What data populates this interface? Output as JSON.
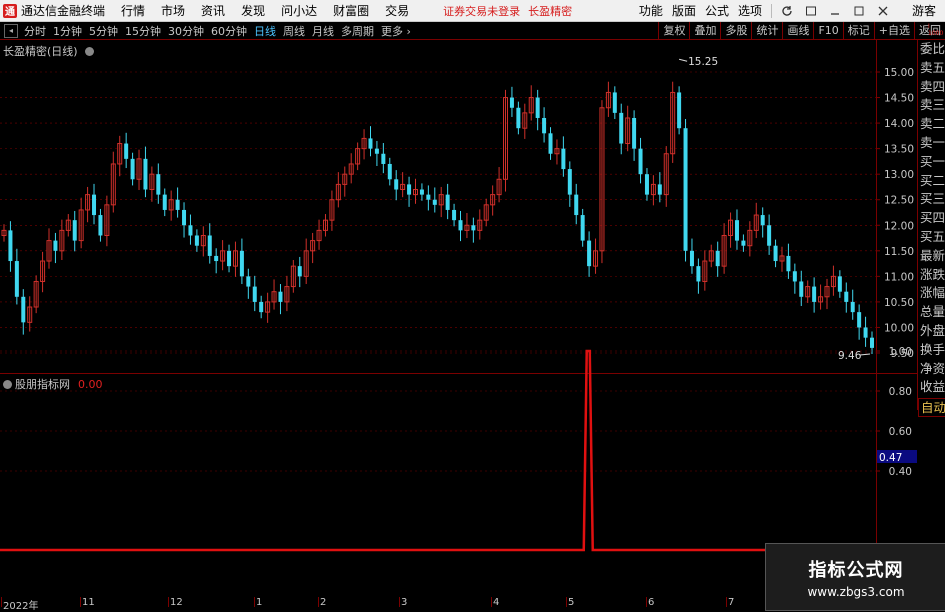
{
  "app": {
    "title": "通达信金融终端",
    "logo_glyph": "通"
  },
  "menu": [
    "行情",
    "市场",
    "资讯",
    "发现",
    "问小达",
    "财富圈",
    "交易"
  ],
  "notice": "证券交易未登录",
  "notice_product": "长盈精密",
  "right_menu": [
    "功能",
    "版面",
    "公式",
    "选项"
  ],
  "guest": "游客",
  "periods": [
    "分时",
    "1分钟",
    "5分钟",
    "15分钟",
    "30分钟",
    "60分钟",
    "日线",
    "周线",
    "月线",
    "多周期",
    "更多"
  ],
  "active_period": "日线",
  "chart_tools": [
    "复权",
    "叠加",
    "多股",
    "统计",
    "画线",
    "F10",
    "标记",
    "+自选",
    "返回"
  ],
  "main_chart": {
    "title": "长盈精密",
    "title_suffix": "(日线)",
    "price_ticks": [
      "15.00",
      "14.50",
      "14.00",
      "13.50",
      "13.00",
      "12.50",
      "12.00",
      "11.50",
      "11.00",
      "10.50",
      "10.00",
      "9.50"
    ],
    "high_label": "15.25",
    "low_label": "9.46"
  },
  "indicator": {
    "title": "股朋指标网",
    "value": "0.00",
    "ticks": [
      "1.00",
      "0.80",
      "0.60",
      "0.40"
    ],
    "current": "0.47"
  },
  "x_labels": [
    "2022年",
    "11",
    "12",
    "1",
    "2",
    "3",
    "4",
    "5",
    "6",
    "7"
  ],
  "quote_column": [
    "委比",
    "卖五",
    "卖四",
    "卖三",
    "卖二",
    "卖一",
    "买一",
    "买二",
    "买三",
    "买四",
    "买五",
    "最新",
    "涨跌",
    "涨幅",
    "总量",
    "外盘",
    "换手",
    "净资",
    "收益"
  ],
  "quote_auto": "自动",
  "top_mini": [
    "Ⅰ",
    "1000"
  ],
  "watermark": {
    "title": "指标公式网",
    "url": "www.zbgs3.com"
  },
  "colors": {
    "up": "#d0302a",
    "down": "#40d8f0",
    "grid": "#7a0000",
    "indicator_line": "#e01010",
    "accent": "#4cc3ff"
  },
  "chart_data": {
    "type": "candlestick",
    "price_range": [
      9.3,
      15.3
    ],
    "closes": [
      11.9,
      11.3,
      10.6,
      10.1,
      10.4,
      10.9,
      11.3,
      11.7,
      11.5,
      11.9,
      12.1,
      11.7,
      12.3,
      12.6,
      12.2,
      11.8,
      12.4,
      13.2,
      13.6,
      13.3,
      12.9,
      13.3,
      12.7,
      13.0,
      12.6,
      12.3,
      12.5,
      12.3,
      12.0,
      11.8,
      11.6,
      11.8,
      11.4,
      11.3,
      11.5,
      11.2,
      11.5,
      11.0,
      10.8,
      10.5,
      10.3,
      10.5,
      10.7,
      10.5,
      10.8,
      11.2,
      11.0,
      11.5,
      11.7,
      11.9,
      12.1,
      12.5,
      12.8,
      13.0,
      13.2,
      13.5,
      13.7,
      13.5,
      13.4,
      13.2,
      12.9,
      12.7,
      12.8,
      12.6,
      12.7,
      12.6,
      12.5,
      12.4,
      12.6,
      12.3,
      12.1,
      11.9,
      12.0,
      11.9,
      12.1,
      12.4,
      12.6,
      12.9,
      14.5,
      14.3,
      13.9,
      14.2,
      14.5,
      14.1,
      13.8,
      13.4,
      13.5,
      13.1,
      12.6,
      12.2,
      11.7,
      11.2,
      11.5,
      14.3,
      14.6,
      14.2,
      13.6,
      14.1,
      13.5,
      13.0,
      12.6,
      12.8,
      12.6,
      13.4,
      14.6,
      13.9,
      11.5,
      11.2,
      10.9,
      11.3,
      11.5,
      11.2,
      11.8,
      12.1,
      11.7,
      11.6,
      11.9,
      12.2,
      12.0,
      11.6,
      11.3,
      11.4,
      11.1,
      10.9,
      10.6,
      10.8,
      10.5,
      10.6,
      10.8,
      11.0,
      10.7,
      10.5,
      10.3,
      10.0,
      9.8,
      9.6
    ],
    "highlight": {
      "high": 15.25,
      "low": 9.46
    },
    "indicator_values_peak": {
      "value": 1.0,
      "position_fraction": 0.623
    }
  }
}
